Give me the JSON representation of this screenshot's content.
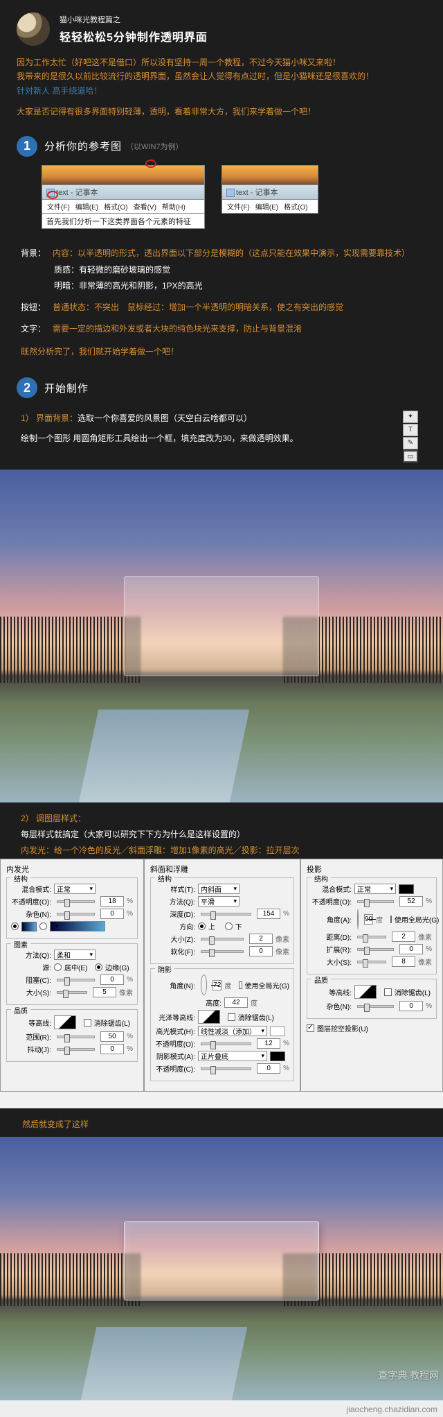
{
  "header": {
    "small": "猫小咪光教程篇之",
    "title": "轻轻松松5分钟制作透明界面"
  },
  "intro": {
    "line1a": "因为工作太忙（好吧这不是借口）所以没有坚持一周一个教程，不过今天猫小咪又来啦！",
    "line2a": "我带来的是很久以前比较流行的透明界面，虽然会让人觉得有点过时，但是小猫咪还是很喜欢的！",
    "line2b": "针对新人 高手绕道哈！",
    "line3": "大家是否记得有很多界面特别轻薄，透明，看着非常大方，我们来学着做一个吧！"
  },
  "section1": {
    "num": "1",
    "title": "分析你的参考图",
    "note": "（以WIN7为例）"
  },
  "ref": {
    "winTitle": "text - 记事本",
    "menu": {
      "file": "文件(F)",
      "edit": "编辑(E)",
      "format": "格式(O)",
      "view": "查看(V)",
      "help": "帮助(H)"
    },
    "content": "首先我们分析一下这类界面各个元素的特征"
  },
  "analysis": {
    "bg_label": "背景：",
    "bg_l1": "内容：以半透明的形式，透出界面以下部分是模糊的（这点只能在效果中演示，实现需要靠技术）",
    "bg_l2": "质感：有轻微的磨砂玻璃的感觉",
    "bg_l3": "明暗：非常薄的高光和阴影，1PX的高光",
    "btn_label": "按钮：",
    "btn_l1": "普通状态：不突出　鼠标经过：增加一个半透明的明暗关系，使之有突出的感觉",
    "txt_label": "文字：",
    "txt_l1": "需要一定的描边和外发或者大块的纯色块光来支撑，防止与背景混淆",
    "end": "既然分析完了，我们就开始学着做一个吧！"
  },
  "section2": {
    "num": "2",
    "title": "开始制作"
  },
  "step1": {
    "num": "1）",
    "label": "界面背景：",
    "body": "选取一个你喜爱的风景图（天空白云啥都可以）",
    "line2": "绘制一个图形 用圆角矩形工具绘出一个框，填充度改为30，来做透明效果。"
  },
  "step2": {
    "num": "2）",
    "label": "调图层样式：",
    "line1": "每层样式就搞定（大家可以研究下下方为什么是这样设置的）",
    "line2": "内发光：给一个冷色的反光／斜面浮雕：增加1像素的高光／投影：拉开层次"
  },
  "panels": {
    "p1": {
      "title": "内发光",
      "struct": "结构",
      "blend": "混合模式:",
      "blend_v": "正常",
      "opacity": "不透明度(O):",
      "opacity_v": "18",
      "pct": "%",
      "noise": "杂色(N):",
      "noise_v": "0",
      "elements": "图素",
      "method": "方法(Q):",
      "method_v": "柔和",
      "source": "源:",
      "src_center": "居中(E)",
      "src_edge": "边缘(G)",
      "choke": "阻塞(C):",
      "choke_v": "0",
      "size": "大小(S):",
      "size_v": "5",
      "px": "像素",
      "quality": "品质",
      "contour": "等高线:",
      "anti": "消除锯齿(L)",
      "range": "范围(R):",
      "range_v": "50",
      "jitter": "抖动(J):",
      "jitter_v": "0"
    },
    "p2": {
      "title": "斜面和浮雕",
      "struct": "结构",
      "style": "样式(T):",
      "style_v": "内斜面",
      "tech": "方法(Q):",
      "tech_v": "平滑",
      "depth": "深度(D):",
      "depth_v": "154",
      "dir": "方向:",
      "dir_up": "上",
      "dir_down": "下",
      "size": "大小(Z):",
      "size_v": "2",
      "px": "像素",
      "soft": "软化(F):",
      "soft_v": "0",
      "shade": "阴影",
      "angle": "角度(N):",
      "angle_v": "72",
      "deg": "度",
      "global": "使用全局光(G)",
      "alt": "高度:",
      "alt_v": "42",
      "gloss": "光泽等高线:",
      "anti": "消除锯齿(L)",
      "hlmode": "高光模式(H):",
      "hlmode_v": "线性减淡（添加）",
      "hlop": "不透明度(O):",
      "hlop_v": "12",
      "shmode": "阴影模式(A):",
      "shmode_v": "正片叠底",
      "shop": "不透明度(C):",
      "shop_v": "0"
    },
    "p3": {
      "title": "投影",
      "struct": "结构",
      "blend": "混合模式:",
      "blend_v": "正常",
      "opacity": "不透明度(O):",
      "opacity_v": "52",
      "angle": "角度(A):",
      "angle_v": "90",
      "deg": "度",
      "global": "使用全局光(G)",
      "dist": "距离(D):",
      "dist_v": "2",
      "px": "像素",
      "spread": "扩展(R):",
      "spread_v": "0",
      "size": "大小(S):",
      "size_v": "8",
      "quality": "品质",
      "contour": "等高线:",
      "anti": "消除锯齿(L)",
      "noise": "杂色(N):",
      "noise_v": "0",
      "knock": "图层挖空投影(U)"
    }
  },
  "result": {
    "label": "然后就变成了这样"
  },
  "watermark": {
    "site": "查字典 教程网",
    "url": "jiaocheng.chazidian.com"
  }
}
